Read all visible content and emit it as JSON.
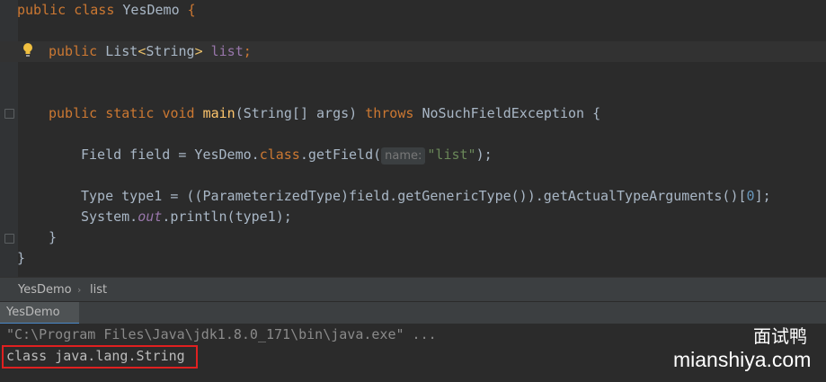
{
  "editor": {
    "line1": {
      "kw1": "public",
      "kw2": "class",
      "name": "YesDemo",
      "brace": "{"
    },
    "line2": {
      "kw": "public",
      "type": "List",
      "lt": "<",
      "generic": "String",
      "gt": ">",
      "var": "list",
      "semi": ";"
    },
    "line3": {
      "kw1": "public",
      "kw2": "static",
      "kw3": "void",
      "method": "main",
      "params": "(String[] args)",
      "throws": "throws",
      "exc": "NoSuchFieldException",
      "brace": "{"
    },
    "line4": {
      "decl": "Field field = YesDemo.",
      "kwclass": "class",
      "call": ".getField(",
      "hint": "name:",
      "str": "\"list\"",
      "end": ");"
    },
    "line5": {
      "decl": "Type type1 = ((ParameterizedType)field.getGenericType()).getActualTypeArguments()[",
      "idx": "0",
      "end": "];"
    },
    "line6": {
      "pre": "System.",
      "out": "out",
      "post": ".println(type1);"
    },
    "line7": {
      "brace": "}"
    },
    "line8": {
      "brace": "}"
    }
  },
  "breadcrumb": {
    "class": "YesDemo",
    "sep": "›",
    "member": "list"
  },
  "run_tab": {
    "label": "YesDemo"
  },
  "console": {
    "command": "\"C:\\Program Files\\Java\\jdk1.8.0_171\\bin\\java.exe\" ...",
    "output": "class java.lang.String"
  },
  "watermark": {
    "cn": "面试鸭",
    "site": "mianshiya.com"
  },
  "colors": {
    "keyword": "#cc7832",
    "method": "#ffc66d",
    "string": "#6a8759",
    "number": "#6897bb",
    "field": "#9876aa",
    "highlight_box": "#e02020"
  }
}
